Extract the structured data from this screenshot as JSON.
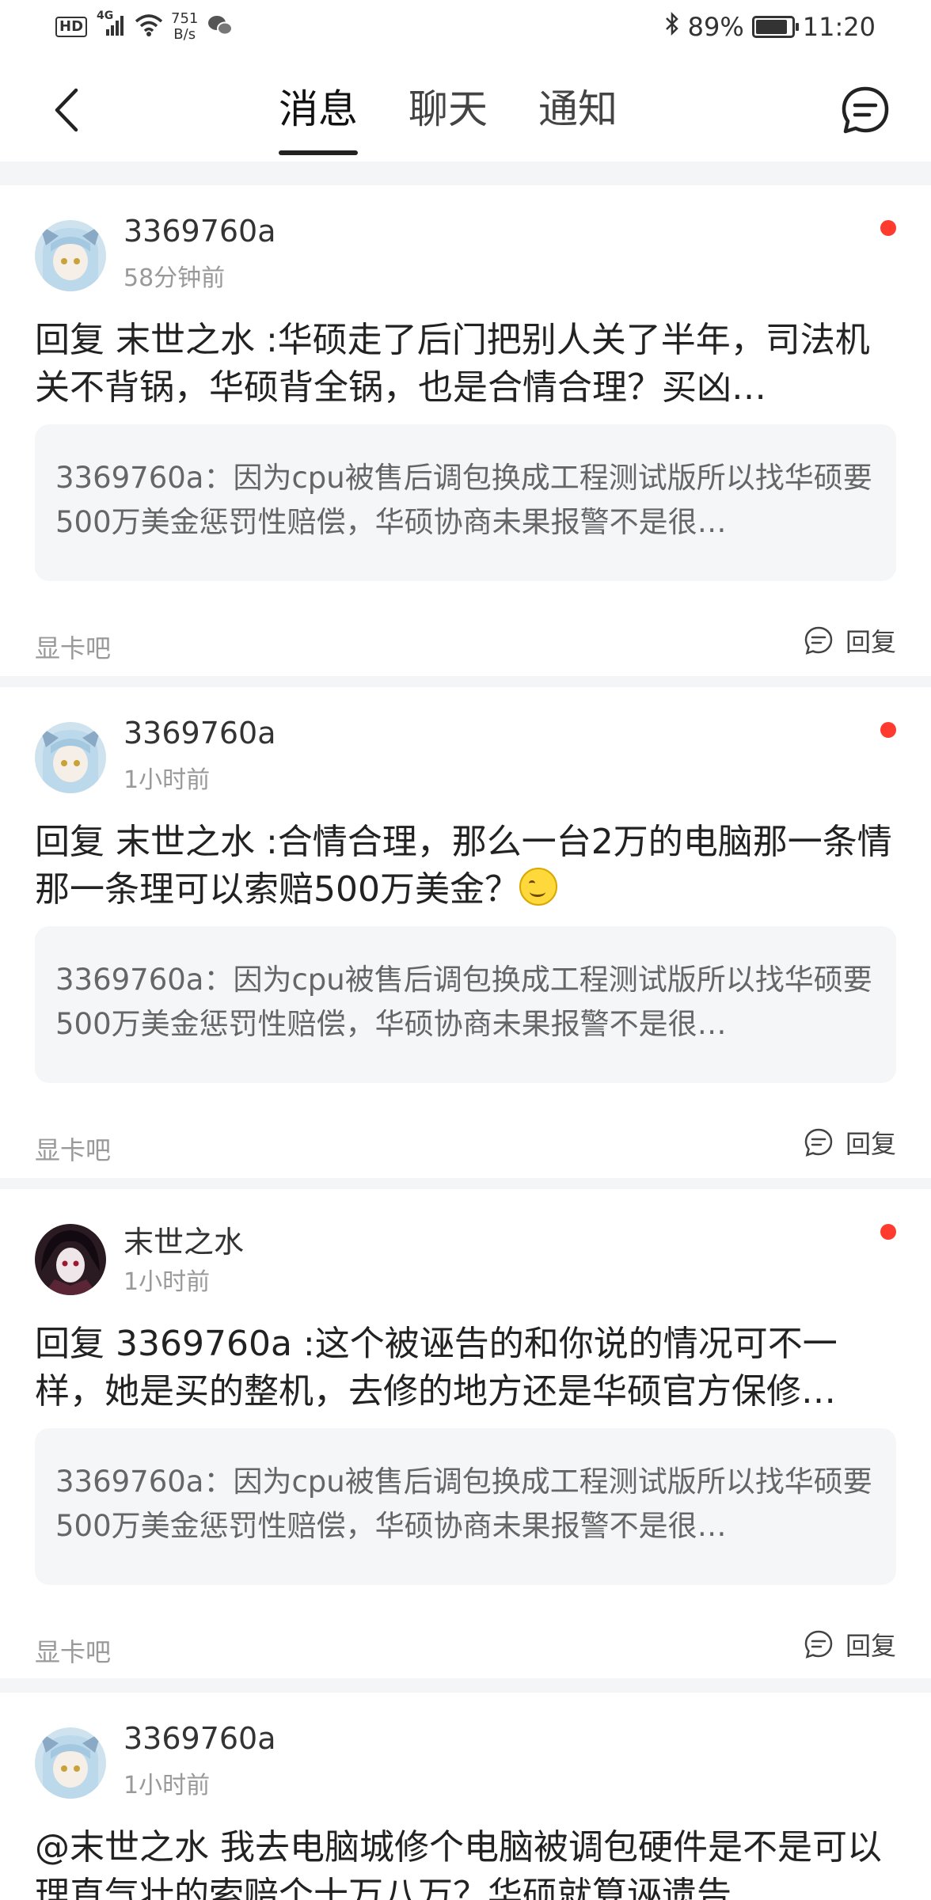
{
  "status_bar": {
    "hd": "HD",
    "signal": "4G",
    "net_speed_value": "751",
    "net_speed_unit": "B/s",
    "battery": "89%",
    "battery_level": 0.89,
    "time": "11:20"
  },
  "nav": {
    "tabs": [
      {
        "label": "消息",
        "active": true
      },
      {
        "label": "聊天",
        "active": false
      },
      {
        "label": "通知",
        "active": false
      }
    ]
  },
  "messages": [
    {
      "user": "3369760a",
      "time": "58分钟前",
      "unread": true,
      "content": "回复 末世之水 :华硕走了后门把别人关了半年，司法机关不背锅，华硕背全锅，也是合情合理？买凶…",
      "quote": "3369760a：因为cpu被售后调包换成工程测试版所以找华硕要500万美金惩罚性赔偿，华硕协商未果报警不是很…",
      "forum": "显卡吧",
      "reply_label": "回复"
    },
    {
      "user": "3369760a",
      "time": "1小时前",
      "unread": true,
      "content": "回复 末世之水 :合情合理，那么一台2万的电脑那一条情那一条理可以索赔500万美金？",
      "quote": "3369760a：因为cpu被售后调包换成工程测试版所以找华硕要500万美金惩罚性赔偿，华硕协商未果报警不是很…",
      "forum": "显卡吧",
      "reply_label": "回复"
    },
    {
      "user": "末世之水",
      "time": "1小时前",
      "unread": true,
      "content": "回复 3369760a :这个被诬告的和你说的情况可不一样，她是买的整机，去修的地方还是华硕官方保修…",
      "quote": "3369760a：因为cpu被售后调包换成工程测试版所以找华硕要500万美金惩罚性赔偿，华硕协商未果报警不是很…",
      "forum": "显卡吧",
      "reply_label": "回复"
    },
    {
      "user": "3369760a",
      "time": "1小时前",
      "unread": false,
      "content": "@末世之水 我去电脑城修个电脑被调包硬件是不是可以理直气壮的索赔个十万八万？华硕就算诬遗告"
    }
  ]
}
